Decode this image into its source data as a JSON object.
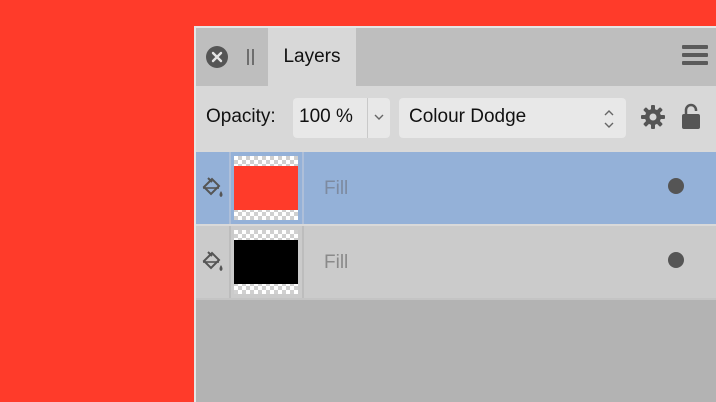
{
  "panel": {
    "tab_label": "Layers"
  },
  "toolbar": {
    "opacity_label": "Opacity:",
    "opacity_value": "100 %",
    "blend_mode": "Colour Dodge"
  },
  "layers": [
    {
      "name": "Fill",
      "swatch_color": "#ff3b2a",
      "selected": true,
      "visible": true
    },
    {
      "name": "Fill",
      "swatch_color": "#000000",
      "selected": false,
      "visible": true
    }
  ],
  "colors": {
    "canvas": "#ff3b2a",
    "selection": "#94b1d8",
    "panel": "#d8d8d8"
  },
  "icons": {
    "close": "close-icon",
    "grip": "grip-icon",
    "menu": "hamburger-menu-icon",
    "opacity_dropdown": "chevron-down-icon",
    "blend_dropdown": "updown-chevron-icon",
    "settings": "gear-icon",
    "lock": "lock-icon",
    "layer_type": "paint-bucket-fill-icon",
    "visibility": "visibility-dot-icon"
  }
}
